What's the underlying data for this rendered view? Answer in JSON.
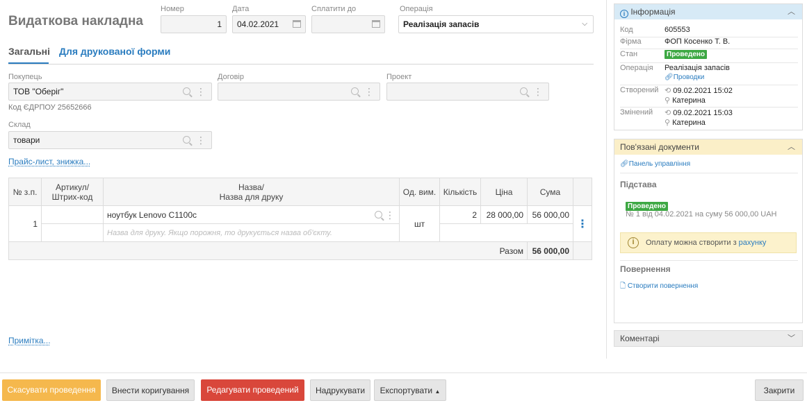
{
  "doc": {
    "title": "Видаткова накладна",
    "number_label": "Номер",
    "number": "1",
    "date_label": "Дата",
    "date": "04.02.2021",
    "pay_until_label": "Сплатити до",
    "pay_until": "",
    "operation_label": "Операція",
    "operation": "Реалізація запасів"
  },
  "tabs": [
    {
      "label": "Загальні",
      "active": true
    },
    {
      "label": "Для друкованої форми",
      "active": false
    }
  ],
  "form": {
    "buyer_label": "Покупець",
    "buyer": "ТОВ \"Оберіг\"",
    "edrpou": "Код ЄДРПОУ 25652666",
    "contract_label": "Договір",
    "contract": "",
    "project_label": "Проект",
    "project": "",
    "warehouse_label": "Склад",
    "warehouse": "товари",
    "pricelist_link": "Прайс-лист, знижка...",
    "note_link": "Примітка..."
  },
  "table": {
    "headers": {
      "num": "№ з.п.",
      "article1": "Артикул/",
      "article2": "Штрих-код",
      "name1": "Назва/",
      "name2": "Назва для друку",
      "unit": "Од. вим.",
      "qty": "Кількість",
      "price": "Ціна",
      "sum": "Сума"
    },
    "rows": [
      {
        "num": "1",
        "article": "",
        "name": "ноутбук Lenovo C1100c",
        "print_name_placeholder": "Назва для друку. Якщо порожня, то друкується назва об'єкту.",
        "unit": "шт",
        "qty": "2",
        "price": "28 000,00",
        "sum": "56 000,00"
      }
    ],
    "total_label": "Разом",
    "total": "56 000,00"
  },
  "buttons": {
    "cancel_posting": "Скасувати проведення",
    "make_correction": "Внести коригування",
    "edit_posted": "Редагувати проведений",
    "print": "Надрукувати",
    "export": "Експортувати",
    "close": "Закрити"
  },
  "info": {
    "header": "Інформація",
    "code_label": "Код",
    "code": "605553",
    "firm_label": "Фірма",
    "firm": "ФОП Косенко Т. В.",
    "state_label": "Стан",
    "state": "Проведено",
    "operation_label": "Операція",
    "operation": "Реалізація запасів",
    "postings_link": "Проводки",
    "created_label": "Створений",
    "created_at": "09.02.2021 15:02",
    "created_by": "Катерина",
    "modified_label": "Змінений",
    "modified_at": "09.02.2021 15:03",
    "modified_by": "Катерина"
  },
  "related": {
    "header": "Пов'язані документи",
    "control_panel_link": "Панель управління",
    "basis_label": "Підстава",
    "basis_state": "Проведено",
    "basis_doc": "№ 1 від 04.02.2021 на суму 56 000,00 UAH",
    "payment_note": "Оплату можна створити з",
    "payment_link": "рахунку",
    "returns_label": "Повернення",
    "create_return_link": "Створити повернення"
  },
  "comments": {
    "header": "Коментарі"
  },
  "colors": {
    "accent_link": "#2a7cbf",
    "posted_green": "#3da843",
    "cancel_orange": "#f5b84d",
    "edit_red": "#d9473b",
    "info_header_bg": "#d7eaf6",
    "related_header_bg": "#fbefc8",
    "warning_bg": "#fcf2cc"
  }
}
